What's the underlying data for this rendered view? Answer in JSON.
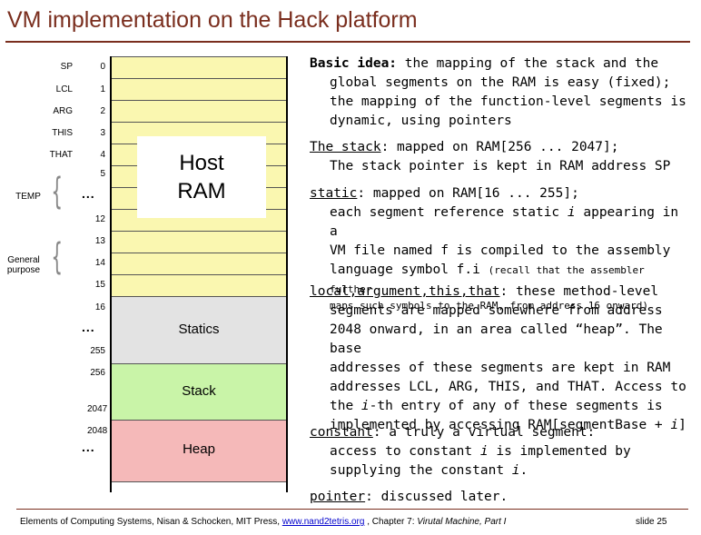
{
  "title": "VM implementation on the Hack platform",
  "memory": {
    "registers": [
      "SP",
      "LCL",
      "ARG",
      "THIS",
      "THAT"
    ],
    "addresses": {
      "a0": "0",
      "a1": "1",
      "a2": "2",
      "a3": "3",
      "a4": "4",
      "a5": "5",
      "a12": "12",
      "a13": "13",
      "a14": "14",
      "a15": "15",
      "a16": "16",
      "a255": "255",
      "a256": "256",
      "a2047": "2047",
      "a2048": "2048"
    },
    "dots": "...",
    "temp_label": "TEMP",
    "general_label": "General purpose",
    "host_ram": [
      "Host",
      "RAM"
    ],
    "segments": {
      "statics": "Statics",
      "stack": "Stack",
      "heap": "Heap"
    }
  },
  "text": {
    "basic_head": "Basic idea:",
    "basic_l1": "the mapping of the stack and the",
    "basic_l2": "global segments on the RAM is easy (fixed);",
    "basic_l3": "the mapping of the function-level segments is",
    "basic_l4": "dynamic, using pointers",
    "stack_head": "The stack",
    "stack_l1": ": mapped on RAM[256 ... 2047];",
    "stack_l2": "The stack pointer is kept in RAM address SP",
    "static_head": "static",
    "static_l1": ": mapped on RAM[16 ... 255];",
    "static_l2a": "each segment reference static ",
    "static_l2i": "i",
    "static_l2b": " appearing in a",
    "static_l3": "VM file named f is compiled to the assembly",
    "static_l4a": "language symbol f.i ",
    "static_l4b": "(recall that the assembler further",
    "static_l5": "maps such symbols to the RAM, from address 16 onward)",
    "local_head": "local,argument,this,that",
    "local_l1": ": these method-level",
    "local_l2": "segments are mapped somewhere from address",
    "local_l3": "2048 onward, in an area called “heap”. The base",
    "local_l4": "addresses of these segments are kept in RAM",
    "local_l5": "addresses LCL, ARG, THIS, and THAT. Access to",
    "local_l6a": "the ",
    "local_l6i": "i",
    "local_l6b": "-th entry of any of these segments is",
    "local_l7a": "implemented by accessing RAM[segmentBase + ",
    "local_l7i": "i",
    "local_l7b": "]",
    "constant_head": "constant",
    "constant_l1": ": a truly a virtual segment:",
    "constant_l2a": "access to constant ",
    "constant_l2i": "i",
    "constant_l2b": " is implemented by",
    "constant_l3a": "supplying the constant ",
    "constant_l3i": "i",
    "constant_l3b": ".",
    "pointer_head": "pointer",
    "pointer_l1": ": discussed later."
  },
  "footer": {
    "left": "Elements of Computing Systems, Nisan & Schocken, MIT Press, ",
    "link": "www.nand2tetris.org",
    "mid": " , Chapter 7: ",
    "chapter": "Virutal Machine, Part I",
    "slide": "slide 25"
  }
}
